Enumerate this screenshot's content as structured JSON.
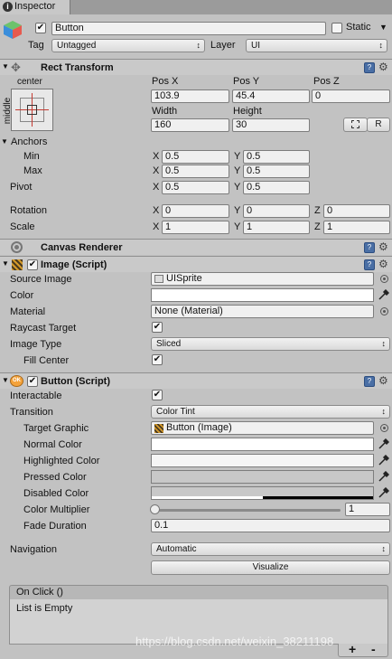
{
  "window": {
    "tab_title": "Inspector"
  },
  "object": {
    "name": "Button",
    "static_label": "Static",
    "tag_label": "Tag",
    "tag_value": "Untagged",
    "layer_label": "Layer",
    "layer_value": "UI"
  },
  "rect_transform": {
    "title": "Rect Transform",
    "anchor_preset_top": "center",
    "anchor_preset_side": "middle",
    "pos_x_label": "Pos X",
    "pos_x": "103.9",
    "pos_y_label": "Pos Y",
    "pos_y": "45.4",
    "pos_z_label": "Pos Z",
    "pos_z": "0",
    "width_label": "Width",
    "width": "160",
    "height_label": "Height",
    "height": "30",
    "raw_button": "R",
    "anchors_label": "Anchors",
    "min_label": "Min",
    "min_x": "0.5",
    "min_y": "0.5",
    "max_label": "Max",
    "max_x": "0.5",
    "max_y": "0.5",
    "pivot_label": "Pivot",
    "pivot_x": "0.5",
    "pivot_y": "0.5",
    "rotation_label": "Rotation",
    "rot_x": "0",
    "rot_y": "0",
    "rot_z": "0",
    "scale_label": "Scale",
    "scale_x": "1",
    "scale_y": "1",
    "scale_z": "1",
    "x": "X",
    "y": "Y",
    "z": "Z"
  },
  "canvas_renderer": {
    "title": "Canvas Renderer"
  },
  "image_script": {
    "title": "Image (Script)",
    "source_image_label": "Source Image",
    "source_image": "UISprite",
    "color_label": "Color",
    "material_label": "Material",
    "material": "None (Material)",
    "raycast_label": "Raycast Target",
    "image_type_label": "Image Type",
    "image_type": "Sliced",
    "fill_center_label": "Fill Center"
  },
  "button_script": {
    "title": "Button (Script)",
    "icon_text": "OK",
    "interactable_label": "Interactable",
    "transition_label": "Transition",
    "transition": "Color Tint",
    "target_graphic_label": "Target Graphic",
    "target_graphic": "Button (Image)",
    "normal_label": "Normal Color",
    "highlighted_label": "Highlighted Color",
    "pressed_label": "Pressed Color",
    "disabled_label": "Disabled Color",
    "multiplier_label": "Color Multiplier",
    "multiplier": "1",
    "fade_label": "Fade Duration",
    "fade": "0.1",
    "navigation_label": "Navigation",
    "navigation": "Automatic",
    "visualize": "Visualize"
  },
  "on_click": {
    "title": "On Click ()",
    "empty": "List is Empty",
    "add": "+",
    "remove": "-"
  },
  "watermark": "https://blog.csdn.net/weixin_38211198",
  "colors": {
    "normal": "#ffffff",
    "highlighted": "#f5f5f5",
    "pressed": "#c8c8c8",
    "disabled": "#c8c8c8"
  }
}
